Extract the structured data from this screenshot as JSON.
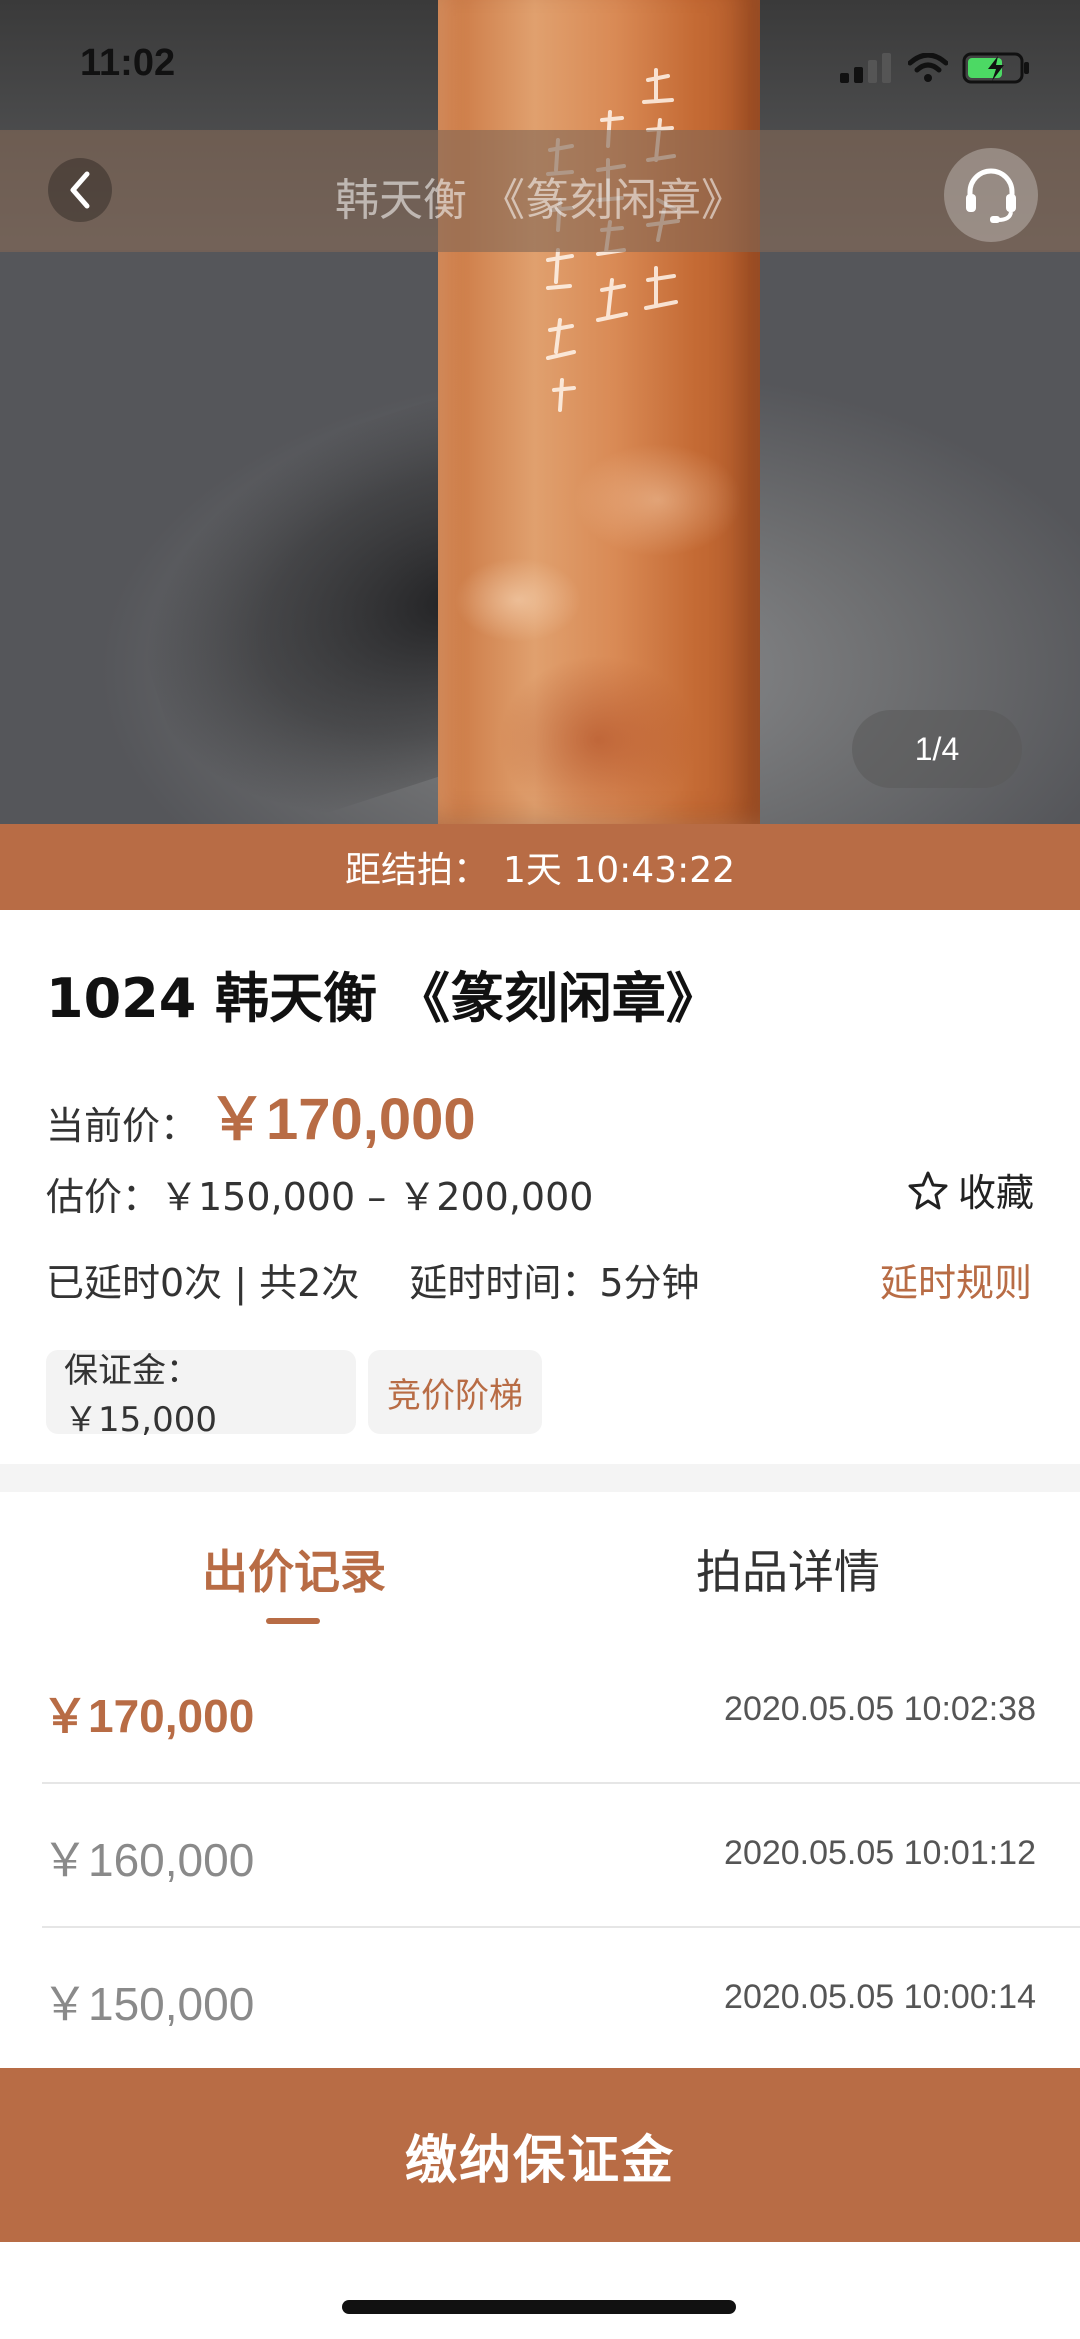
{
  "status_bar": {
    "time": "11:02"
  },
  "nav": {
    "title": "韩天衡 《篆刻闲章》"
  },
  "hero": {
    "page_indicator": "1/4"
  },
  "countdown": {
    "label": "距结拍：",
    "value": "1天 10:43:22"
  },
  "lot": {
    "title": "1024 韩天衡 《篆刻闲章》",
    "current_price_label": "当前价：",
    "current_price": "￥170,000",
    "estimate": "估价：￥150,000 – ￥200,000",
    "favorite_label": "收藏",
    "extend_count": "已延时0次 | 共2次",
    "extend_time": "延时时间：5分钟",
    "extend_rule": "延时规则",
    "deposit": "保证金：￥15,000",
    "bid_ladder": "竞价阶梯"
  },
  "tabs": [
    {
      "label": "出价记录",
      "active": true
    },
    {
      "label": "拍品详情",
      "active": false
    }
  ],
  "bids": [
    {
      "amount": "￥170,000",
      "time": "2020.05.05 10:02:38"
    },
    {
      "amount": "￥160,000",
      "time": "2020.05.05 10:01:12"
    },
    {
      "amount": "￥150,000",
      "time": "2020.05.05 10:00:14"
    }
  ],
  "actions": {
    "pay_deposit": "缴纳保证金"
  },
  "colors": {
    "accent": "#b86c45",
    "nav_overlay": "#826856"
  }
}
